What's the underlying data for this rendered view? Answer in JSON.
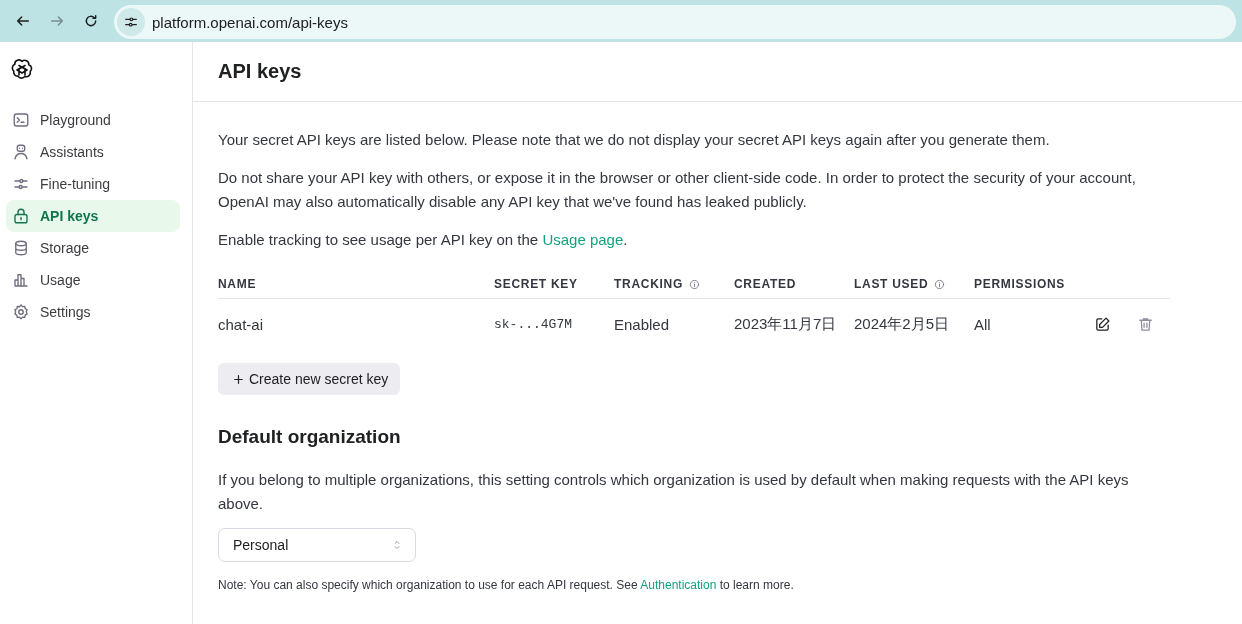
{
  "browser": {
    "url": "platform.openai.com/api-keys",
    "forward_disabled": true
  },
  "sidebar": {
    "items": [
      {
        "label": "Playground",
        "selected": false
      },
      {
        "label": "Assistants",
        "selected": false
      },
      {
        "label": "Fine-tuning",
        "selected": false
      },
      {
        "label": "API keys",
        "selected": true
      },
      {
        "label": "Storage",
        "selected": false
      },
      {
        "label": "Usage",
        "selected": false
      },
      {
        "label": "Settings",
        "selected": false
      }
    ]
  },
  "page": {
    "title": "API keys",
    "paragraphs": [
      {
        "before": "Your secret API keys are listed below. Please note that we do not display your secret API keys again after you generate them."
      },
      {
        "before": "Do not share your API key with others, or expose it in the browser or other client-side code. In order to protect the security of your account, OpenAI may also automatically disable any API key that we've found has leaked publicly."
      },
      {
        "before": "Enable tracking to see usage per API key on the ",
        "link": "Usage page",
        "after": "."
      }
    ],
    "table": {
      "columns": [
        {
          "label": "NAME",
          "info": false
        },
        {
          "label": "SECRET KEY",
          "info": false
        },
        {
          "label": "TRACKING",
          "info": true
        },
        {
          "label": "CREATED",
          "info": false
        },
        {
          "label": "LAST USED",
          "info": true
        },
        {
          "label": "PERMISSIONS",
          "info": false
        }
      ],
      "rows": [
        {
          "cells": [
            "chat-ai",
            "sk-...4G7M",
            "Enabled",
            "2023年11月7日",
            "2024年2月5日",
            "All"
          ]
        }
      ]
    },
    "create_button": "Create new secret key",
    "org": {
      "title": "Default organization",
      "description": "If you belong to multiple organizations, this setting controls which organization is used by default when making requests with the API keys above.",
      "select_value": "Personal",
      "note": {
        "before": "Note: You can also specify which organization to use for each API request. See ",
        "link": "Authentication",
        "after": " to learn more."
      }
    }
  }
}
